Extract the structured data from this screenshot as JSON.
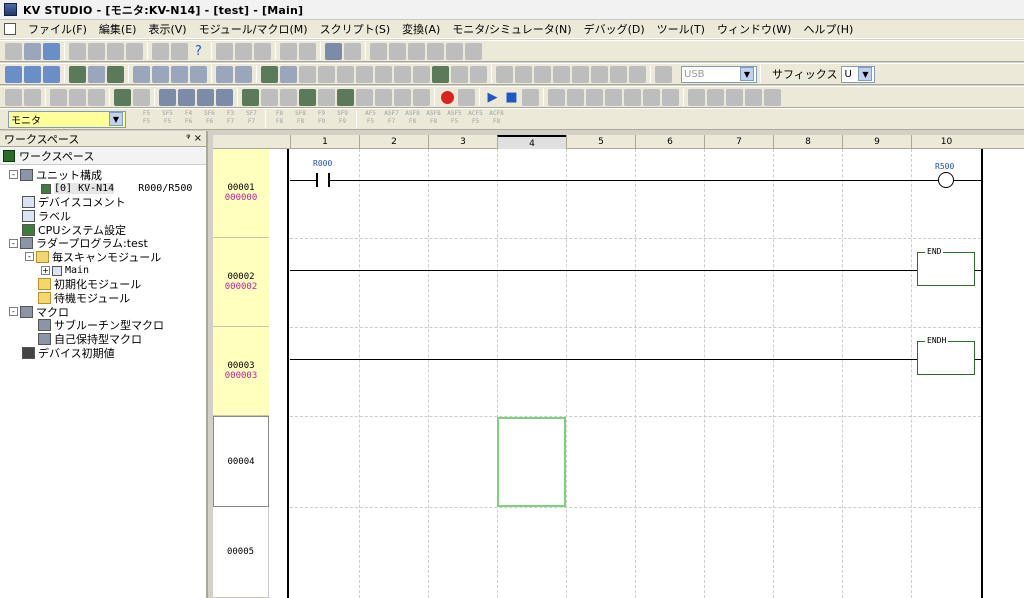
{
  "window": {
    "title": "KV STUDIO - [モニタ:KV-N14] - [test] - [Main]"
  },
  "menu": [
    "ファイル(F)",
    "編集(E)",
    "表示(V)",
    "モジュール/マクロ(M)",
    "スクリプト(S)",
    "変換(A)",
    "モニタ/シミュレータ(N)",
    "デバッグ(D)",
    "ツール(T)",
    "ウィンドウ(W)",
    "ヘルプ(H)"
  ],
  "toolbar": {
    "connection_value": "USB",
    "suffix_label": "サフィックス",
    "suffix_value": "U",
    "mode_value": "モニタ",
    "fkeys": [
      [
        "F5",
        "F5"
      ],
      [
        "SF5",
        "F5"
      ],
      [
        "F4",
        "F6"
      ],
      [
        "SF6",
        "F6"
      ],
      [
        "F3",
        "F7"
      ],
      [
        "SF7",
        "F7"
      ],
      [
        "F8",
        "F8"
      ],
      [
        "SF8",
        "F8"
      ],
      [
        "F9",
        "F9"
      ],
      [
        "SF9",
        "F9"
      ],
      [
        "AF5",
        "F5"
      ],
      [
        "ASF7",
        "F7"
      ],
      [
        "ASF8",
        "F8"
      ],
      [
        "ASF8",
        "F8"
      ],
      [
        "ASF5",
        "F5"
      ],
      [
        "ACF5",
        "F5"
      ],
      [
        "ACF8",
        "F8"
      ]
    ]
  },
  "workspace": {
    "header": "ワークスペース",
    "header_controls": "ᵠ ×",
    "tab": "ワークスペース",
    "tree": [
      {
        "label": "ユニット構成",
        "level": 0,
        "expander": "-",
        "icon": "unit-config-icon"
      },
      {
        "label": "[0]  KV-N14",
        "extra": "R000/R500",
        "level": 2,
        "icon": "cpu-unit-icon"
      },
      {
        "label": "デバイスコメント",
        "level": 0,
        "icon": "device-comment-icon"
      },
      {
        "label": "ラベル",
        "level": 0,
        "icon": "label-icon"
      },
      {
        "label": "CPUシステム設定",
        "level": 0,
        "icon": "cpu-settings-icon"
      },
      {
        "label": "ラダープログラム:test",
        "level": 0,
        "expander": "-",
        "icon": "ladder-program-icon"
      },
      {
        "label": "毎スキャンモジュール",
        "level": 1,
        "expander": "-",
        "icon": "folder-icon"
      },
      {
        "label": "Main",
        "level": 2,
        "expander": "+",
        "icon": "module-icon"
      },
      {
        "label": "初期化モジュール",
        "level": 1,
        "icon": "folder-icon"
      },
      {
        "label": "待機モジュール",
        "level": 1,
        "icon": "folder-icon"
      },
      {
        "label": "マクロ",
        "level": 0,
        "expander": "-",
        "icon": "macro-icon"
      },
      {
        "label": "サブルーチン型マクロ",
        "level": 1,
        "icon": "subroutine-macro-icon"
      },
      {
        "label": "自己保持型マクロ",
        "level": 1,
        "icon": "self-hold-macro-icon"
      },
      {
        "label": "デバイス初期値",
        "level": 0,
        "icon": "device-initial-value-icon"
      }
    ]
  },
  "ladder": {
    "columns": [
      "1",
      "2",
      "3",
      "4",
      "5",
      "6",
      "7",
      "8",
      "9",
      "10"
    ],
    "active_column": "4",
    "rows": [
      {
        "line": "00001",
        "step": "000000"
      },
      {
        "line": "00002",
        "step": "000002"
      },
      {
        "line": "00003",
        "step": "000003"
      },
      {
        "line": "00004",
        "step": ""
      },
      {
        "line": "00005",
        "step": ""
      }
    ],
    "contact_label": "R000",
    "coil_label": "R500",
    "instructions": [
      "END",
      "ENDH"
    ]
  },
  "colors": {
    "row_header_bg": "#ffffbe",
    "step_text": "#c020a0",
    "device_label": "#1f4fb5",
    "cursor": "#7fd17f",
    "mode_combo_bg": "#ffff99"
  }
}
